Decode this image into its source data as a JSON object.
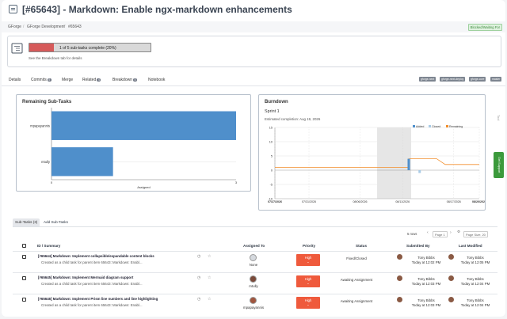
{
  "header": {
    "title": "[#65643] - Markdown: Enable ngx-markdown enhancements"
  },
  "breadcrumb": {
    "items": [
      "GForge",
      "GForge Development",
      "#65643"
    ],
    "status_badge": "Blocked/Waiting For"
  },
  "summary": {
    "progress_label": "1 of 5 sub-tasks complete (20%)",
    "progress": 0.2,
    "note": "See the Breakdown tab for details"
  },
  "tabs": [
    {
      "label": "Details",
      "count": ""
    },
    {
      "label": "Commits",
      "count": "5"
    },
    {
      "label": "Merge",
      "count": ""
    },
    {
      "label": "Related",
      "count": "4"
    },
    {
      "label": "Breakdown",
      "count": "5"
    },
    {
      "label": "Notebook",
      "count": ""
    }
  ],
  "tags": [
    "gforge-next",
    "gforge-next-deploy",
    "gforge-core",
    "master"
  ],
  "remaining_panel": {
    "title": "Remaining Sub-Tasks",
    "chart_data": {
      "type": "bar",
      "orientation": "horizontal",
      "categories": [
        "mpapayannis",
        "mtully"
      ],
      "values": [
        3,
        1
      ],
      "xlabel": "Assigned",
      "xlim": [
        0,
        3
      ],
      "x_ticks": [
        "0",
        "3"
      ],
      "color": "#4f8fcb"
    }
  },
  "burndown_panel": {
    "title": "Burndown",
    "sprint": "Sprint 1",
    "estimate": "Estimated completion: Aug 19, 2026",
    "chart_data": {
      "type": "line",
      "legend": [
        "Added",
        "Closed",
        "Remaining"
      ],
      "legend_colors": [
        "#4f8fcb",
        "#a9cbe6",
        "#f28e2b"
      ],
      "y_ticks": [
        "15",
        "10",
        "5",
        "0",
        "-5",
        "-10"
      ],
      "ylim": [
        -10,
        15
      ],
      "x_ticks": [
        "07/27/2026",
        "07/31/2026",
        "08/06/2026",
        "08/11/2026",
        "08/17/2026",
        "08/20/2026"
      ],
      "remaining_level": [
        1,
        1,
        1,
        1,
        4,
        2,
        2
      ],
      "added": [
        {
          "x": "08/12/2026",
          "value": 4
        }
      ],
      "closed": [
        {
          "x": "08/13/2026",
          "value": -1
        }
      ]
    }
  },
  "rail": {
    "label": "Tool",
    "support_label": "Get Support"
  },
  "subtasks": {
    "tabs": [
      "Sub-Tasks (3)",
      "Add Sub-Tasks"
    ],
    "rows_label": "5 rows",
    "page_label": "Page 1",
    "page_size_label": "Page Size: 20",
    "columns": [
      "ID / Summary",
      "Assigned To",
      "Priority",
      "Status",
      "Submitted By",
      "Last Modified"
    ],
    "rows": [
      {
        "title": "[#65644] Markdown: Implement collapsible/expandable content blocks",
        "desc": "Created as a child task for parent item 65643: Markdown: Enabl...",
        "assignee": "None",
        "priority": "High",
        "status": "Fixed/Closed",
        "submitter": "Tony Bibbs",
        "submitted": "Today at 12:02 PM",
        "modifier": "Tony Bibbs",
        "modified": "Today at 12:05 PM"
      },
      {
        "title": "[#65645] Markdown: Implement Mermaid diagram support",
        "desc": "Created as a child task for parent item 65643: Markdown: Enabl...",
        "assignee": "mtully",
        "priority": "High",
        "status": "Awaiting Assignment",
        "submitter": "Tony Bibbs",
        "submitted": "Today at 12:03 PM",
        "modifier": "Tony Bibbs",
        "modified": "Today at 12:04 PM"
      },
      {
        "title": "[#65646] Markdown: Implement Prism line numbers and line highlighting",
        "desc": "Created as a child task for parent item 65643: Markdown: Enabl...",
        "assignee": "mpapayannis",
        "priority": "High",
        "status": "Awaiting Assignment",
        "submitter": "Tony Bibbs",
        "submitted": "Today at 12:03 PM",
        "modifier": "Tony Bibbs",
        "modified": "Today at 12:04 PM"
      }
    ]
  }
}
